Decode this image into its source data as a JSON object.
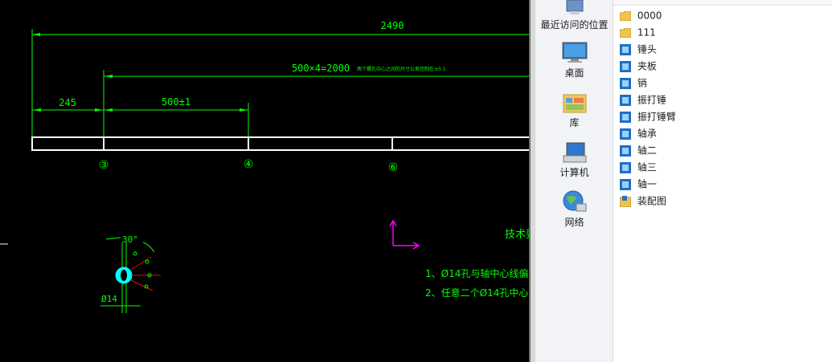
{
  "cad": {
    "dim_total": "2490",
    "dim_series": "500×4=2000",
    "dim_series_note": "两个螺孔中心之间的尺寸公差控制在±0.1",
    "dim_left": "245",
    "dim_pitch": "500±1",
    "marker_3": "③",
    "marker_4": "④",
    "marker_6": "⑥",
    "angle_label": "30°",
    "diameter_label": "Ø14",
    "tech_title": "技术要",
    "note_1": "1、Ø14孔与轴中心线偏",
    "note_2": "2、任意二个Ø14孔中心"
  },
  "nav": {
    "items": [
      {
        "label": "最近访问的位置",
        "icon": "recent-places-icon"
      },
      {
        "label": "桌面",
        "icon": "desktop-icon"
      },
      {
        "label": "库",
        "icon": "library-icon"
      },
      {
        "label": "计算机",
        "icon": "computer-icon"
      },
      {
        "label": "网络",
        "icon": "network-icon"
      }
    ]
  },
  "files": {
    "items": [
      {
        "name": "0000",
        "type": "folder"
      },
      {
        "name": "111",
        "type": "folder"
      },
      {
        "name": "锤头",
        "type": "part"
      },
      {
        "name": "夹板",
        "type": "part"
      },
      {
        "name": "销",
        "type": "part"
      },
      {
        "name": "振打锤",
        "type": "part"
      },
      {
        "name": "振打锤臂",
        "type": "part"
      },
      {
        "name": "轴承",
        "type": "part"
      },
      {
        "name": "轴二",
        "type": "part"
      },
      {
        "name": "轴三",
        "type": "part"
      },
      {
        "name": "轴一",
        "type": "part"
      },
      {
        "name": "装配图",
        "type": "assembly"
      }
    ]
  },
  "colors": {
    "cad_bg": "#000000",
    "dim_green": "#00ff00",
    "annot_red": "#ff0000",
    "ucs_magenta": "#ff00ff",
    "hole_cyan": "#00ffff",
    "outline_white": "#ffffff"
  }
}
